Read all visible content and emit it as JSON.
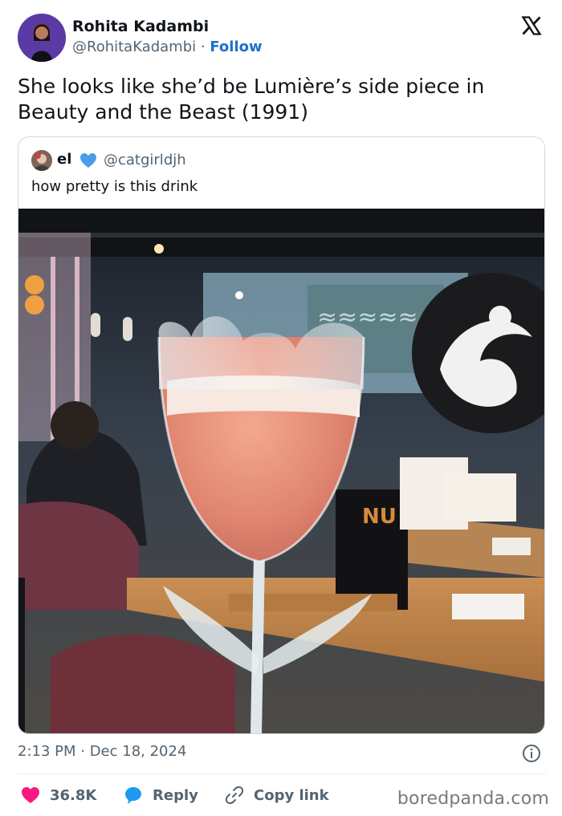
{
  "author": {
    "name": "Rohita Kadambi",
    "handle": "@RohitaKadambi",
    "separator": "·",
    "follow_label": "Follow"
  },
  "tweet": {
    "text": "She looks like she’d be Lumière’s side piece in Beauty and the Beast (1991)",
    "timestamp": "2:13 PM · Dec 18, 2024"
  },
  "quoted": {
    "name": "el",
    "handle": "@catgirldjh",
    "text": "how pretty is this drink",
    "photo_sign_text": "NU"
  },
  "actions": {
    "like_count": "36.8K",
    "reply_label": "Reply",
    "copy_label": "Copy link"
  },
  "watermark": "boredpanda.com",
  "icons": {
    "brand": "x-logo-icon",
    "like": "heart-icon",
    "reply": "speech-bubble-icon",
    "copy": "link-icon",
    "info": "info-icon",
    "verified": "verified-heart-icon"
  },
  "colors": {
    "like": "#f91880",
    "reply": "#1d9bf0",
    "follow": "#1d72c6",
    "muted": "#536471",
    "verified": "#4a9de8"
  }
}
